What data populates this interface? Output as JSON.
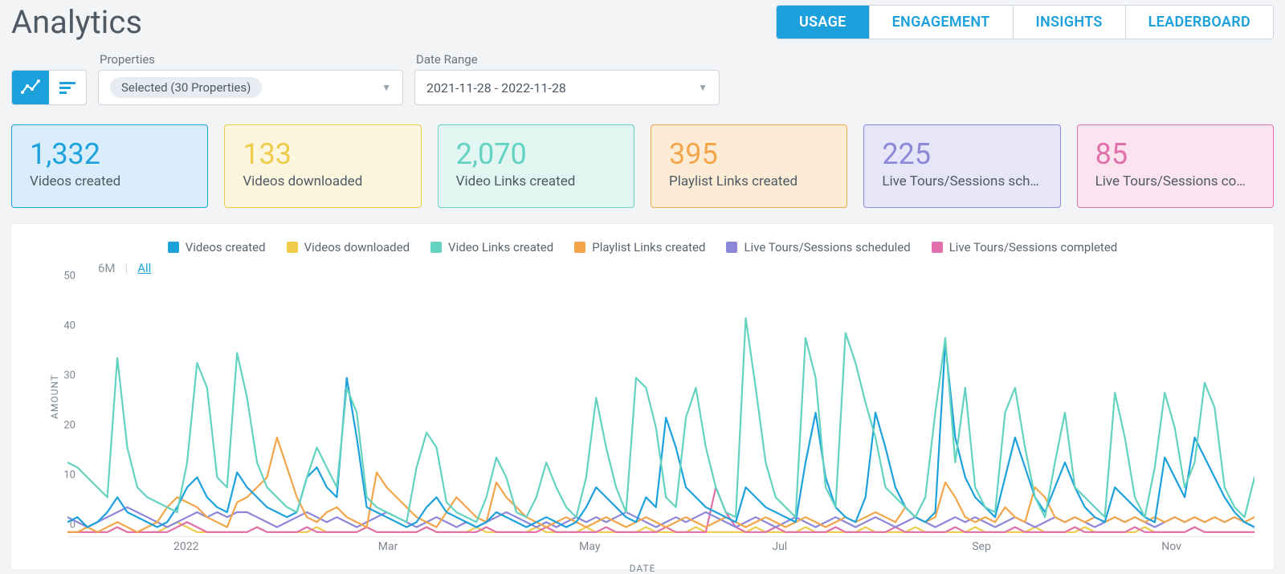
{
  "header": {
    "title": "Analytics",
    "tabs": [
      "USAGE",
      "ENGAGEMENT",
      "INSIGHTS",
      "LEADERBOARD"
    ],
    "active_tab": 0
  },
  "filters": {
    "properties_label": "Properties",
    "properties_value": "Selected (30 Properties)",
    "date_label": "Date Range",
    "date_value": "2021-11-28 - 2022-11-28"
  },
  "range_toggle": {
    "six_m": "6M",
    "all": "All",
    "active": "all"
  },
  "cards": [
    {
      "value": "1,332",
      "label": "Videos created",
      "cls": "blue"
    },
    {
      "value": "133",
      "label": "Videos downloaded",
      "cls": "yellow"
    },
    {
      "value": "2,070",
      "label": "Video Links created",
      "cls": "teal"
    },
    {
      "value": "395",
      "label": "Playlist Links created",
      "cls": "orange"
    },
    {
      "value": "225",
      "label": "Live Tours/Sessions sche…",
      "cls": "purple"
    },
    {
      "value": "85",
      "label": "Live Tours/Sessions com…",
      "cls": "pink"
    }
  ],
  "chart_data": {
    "type": "line",
    "title": "",
    "xlabel": "DATE",
    "ylabel": "AMOUNT",
    "ylim": [
      0,
      50
    ],
    "y_ticks": [
      0,
      10,
      20,
      30,
      40,
      50
    ],
    "x_ticks": [
      "2022",
      "Mar",
      "May",
      "Jul",
      "Sep",
      "Nov"
    ],
    "x_tick_positions": [
      0.1,
      0.27,
      0.44,
      0.6,
      0.77,
      0.93
    ],
    "n": 120,
    "legend_colors": {
      "Videos created": "#1ca1dc",
      "Videos downloaded": "#eecb4b",
      "Video Links created": "#63d2c0",
      "Playlist Links created": "#f3a54a",
      "Live Tours/Sessions scheduled": "#8c87d9",
      "Live Tours/Sessions completed": "#e06fab"
    },
    "series": [
      {
        "name": "Video Links created",
        "color": "#63d2c0",
        "values": [
          15,
          14,
          12,
          10,
          8,
          36,
          18,
          10,
          8,
          7,
          6,
          5,
          15,
          35,
          30,
          12,
          10,
          37,
          28,
          15,
          10,
          8,
          6,
          5,
          12,
          18,
          14,
          10,
          30,
          25,
          8,
          6,
          5,
          4,
          3,
          14,
          21,
          18,
          7,
          5,
          4,
          3,
          8,
          16,
          12,
          5,
          4,
          8,
          15,
          10,
          6,
          4,
          12,
          28,
          18,
          10,
          5,
          32,
          30,
          22,
          8,
          6,
          24,
          30,
          18,
          10,
          5,
          4,
          44,
          30,
          15,
          8,
          6,
          4,
          40,
          32,
          10,
          6,
          41,
          35,
          27,
          20,
          10,
          8,
          6,
          4,
          8,
          25,
          40,
          15,
          30,
          10,
          6,
          5,
          25,
          30,
          18,
          8,
          4,
          15,
          25,
          10,
          8,
          6,
          4,
          29,
          20,
          8,
          4,
          14,
          29,
          22,
          10,
          15,
          31,
          26,
          10,
          6,
          4,
          12
        ]
      },
      {
        "name": "Videos created",
        "color": "#1ca1dc",
        "values": [
          3,
          4,
          2,
          3,
          5,
          8,
          5,
          4,
          3,
          2,
          3,
          6,
          10,
          12,
          8,
          6,
          5,
          13,
          10,
          8,
          6,
          5,
          4,
          5,
          12,
          14,
          10,
          8,
          32,
          20,
          6,
          5,
          4,
          3,
          2,
          3,
          6,
          8,
          5,
          4,
          3,
          2,
          3,
          5,
          4,
          3,
          2,
          3,
          4,
          3,
          2,
          3,
          6,
          10,
          8,
          6,
          4,
          3,
          8,
          6,
          24,
          18,
          10,
          8,
          6,
          5,
          4,
          3,
          10,
          8,
          6,
          5,
          4,
          3,
          15,
          25,
          12,
          6,
          4,
          3,
          8,
          25,
          18,
          10,
          6,
          4,
          3,
          5,
          39,
          20,
          12,
          8,
          6,
          4,
          12,
          20,
          14,
          8,
          5,
          10,
          15,
          10,
          6,
          4,
          3,
          10,
          8,
          6,
          4,
          3,
          16,
          12,
          8,
          20,
          16,
          12,
          8,
          5,
          3,
          2
        ]
      },
      {
        "name": "Playlist Links created",
        "color": "#f3a54a",
        "values": [
          1,
          1,
          2,
          1,
          2,
          3,
          2,
          1,
          2,
          3,
          6,
          8,
          7,
          6,
          4,
          3,
          2,
          7,
          8,
          10,
          12,
          20,
          14,
          8,
          4,
          3,
          5,
          6,
          4,
          3,
          2,
          13,
          10,
          8,
          6,
          4,
          3,
          2,
          5,
          8,
          6,
          4,
          3,
          11,
          8,
          6,
          4,
          3,
          2,
          3,
          4,
          3,
          2,
          3,
          4,
          3,
          2,
          3,
          4,
          3,
          2,
          3,
          4,
          3,
          2,
          3,
          4,
          3,
          2,
          3,
          4,
          3,
          2,
          3,
          4,
          3,
          2,
          3,
          4,
          3,
          4,
          5,
          4,
          3,
          6,
          4,
          3,
          4,
          11,
          8,
          4,
          3,
          4,
          3,
          6,
          4,
          3,
          10,
          8,
          4,
          3,
          4,
          3,
          4,
          3,
          4,
          3,
          4,
          3,
          4,
          3,
          4,
          3,
          4,
          3,
          4,
          3,
          4,
          3,
          4
        ]
      },
      {
        "name": "Live Tours/Sessions scheduled",
        "color": "#8c87d9",
        "values": [
          4,
          3,
          2,
          3,
          4,
          5,
          6,
          5,
          4,
          3,
          2,
          3,
          4,
          5,
          4,
          5,
          4,
          5,
          5,
          4,
          3,
          2,
          3,
          4,
          5,
          4,
          3,
          4,
          3,
          2,
          3,
          4,
          5,
          4,
          3,
          2,
          3,
          4,
          3,
          2,
          3,
          2,
          3,
          4,
          5,
          4,
          3,
          2,
          3,
          2,
          3,
          4,
          3,
          4,
          3,
          4,
          5,
          4,
          3,
          2,
          3,
          4,
          3,
          4,
          5,
          4,
          3,
          2,
          3,
          4,
          3,
          2,
          3,
          4,
          3,
          2,
          3,
          4,
          3,
          2,
          3,
          4,
          3,
          2,
          3,
          4,
          3,
          2,
          3,
          4,
          3,
          4,
          3,
          2,
          3,
          4,
          3,
          2,
          3,
          4,
          3,
          4,
          3,
          2,
          3,
          4,
          3,
          4,
          3,
          2,
          3,
          4,
          3,
          4,
          3,
          4,
          3,
          4,
          3,
          2
        ]
      },
      {
        "name": "Videos downloaded",
        "color": "#eecb4b",
        "values": [
          1,
          1,
          1,
          1,
          1,
          2,
          1,
          1,
          1,
          1,
          2,
          3,
          2,
          1,
          1,
          1,
          1,
          1,
          1,
          2,
          1,
          1,
          1,
          1,
          1,
          2,
          1,
          1,
          1,
          1,
          2,
          1,
          1,
          1,
          1,
          1,
          2,
          1,
          1,
          1,
          1,
          2,
          1,
          1,
          1,
          1,
          1,
          2,
          1,
          1,
          1,
          1,
          2,
          1,
          1,
          1,
          1,
          1,
          2,
          1,
          1,
          1,
          1,
          2,
          1,
          1,
          1,
          1,
          1,
          2,
          1,
          1,
          1,
          1,
          2,
          1,
          1,
          1,
          1,
          1,
          2,
          1,
          1,
          1,
          1,
          2,
          1,
          1,
          1,
          1,
          1,
          2,
          1,
          1,
          1,
          1,
          1,
          2,
          1,
          1,
          1,
          1,
          2,
          1,
          1,
          1,
          1,
          1,
          2,
          1,
          1,
          1,
          1,
          2,
          1,
          1,
          1,
          1,
          1,
          1
        ]
      },
      {
        "name": "Live Tours/Sessions completed",
        "color": "#e06fab",
        "values": [
          1,
          1,
          1,
          1,
          1,
          2,
          1,
          1,
          1,
          1,
          1,
          2,
          3,
          2,
          1,
          1,
          1,
          1,
          1,
          2,
          1,
          1,
          1,
          1,
          2,
          1,
          1,
          1,
          1,
          1,
          2,
          1,
          1,
          1,
          1,
          1,
          2,
          1,
          1,
          1,
          1,
          1,
          2,
          1,
          1,
          1,
          1,
          1,
          2,
          1,
          1,
          1,
          1,
          1,
          2,
          1,
          1,
          1,
          1,
          1,
          2,
          1,
          1,
          1,
          1,
          10,
          5,
          2,
          1,
          1,
          1,
          2,
          1,
          1,
          1,
          1,
          1,
          2,
          1,
          1,
          1,
          1,
          1,
          2,
          1,
          1,
          1,
          1,
          1,
          2,
          1,
          1,
          1,
          1,
          1,
          2,
          1,
          1,
          1,
          1,
          1,
          2,
          1,
          1,
          1,
          1,
          1,
          2,
          1,
          1,
          1,
          1,
          1,
          2,
          1,
          1,
          1,
          1,
          1,
          1
        ]
      }
    ]
  }
}
